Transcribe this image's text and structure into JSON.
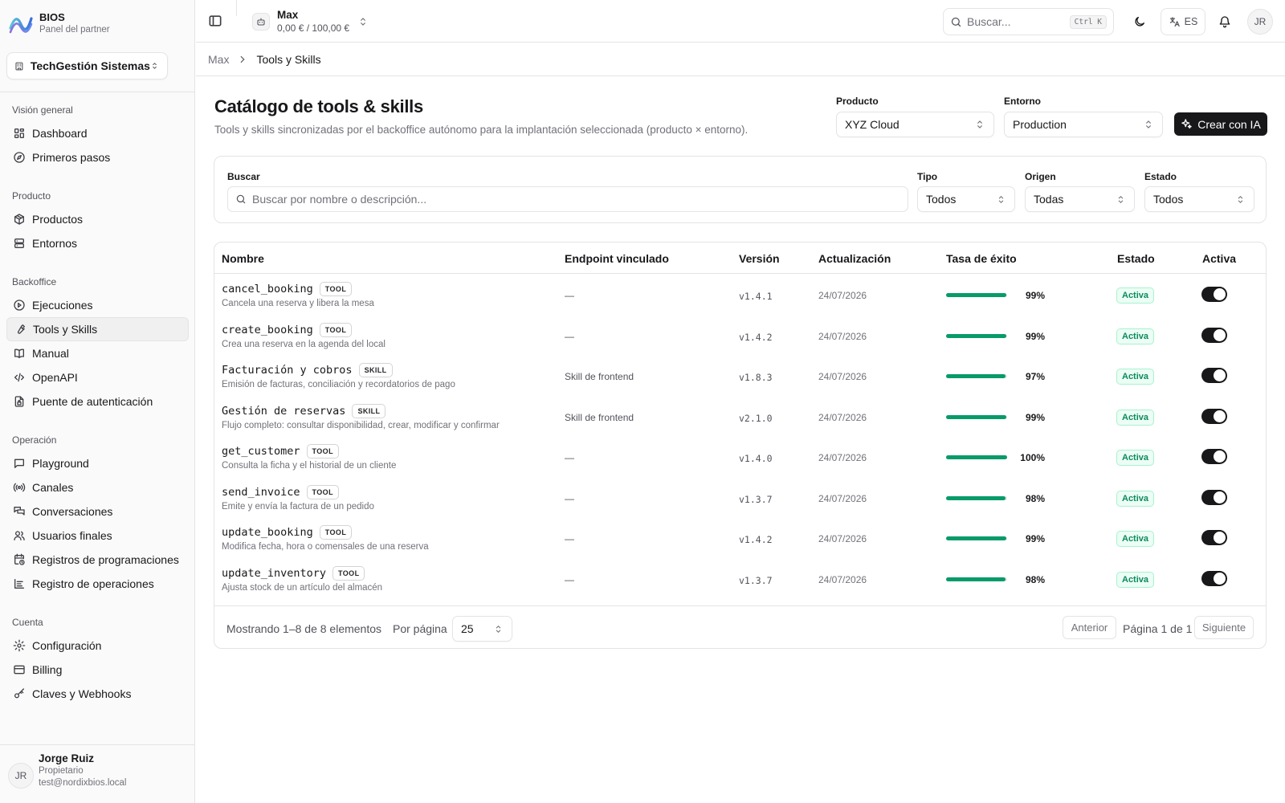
{
  "brand": {
    "title": "BIOS",
    "subtitle": "Panel del partner"
  },
  "org": {
    "name": "TechGestión Sistemas"
  },
  "sidebar": {
    "groups": [
      {
        "label": "Visión general",
        "items": [
          {
            "label": "Dashboard",
            "icon": "dashboard-icon"
          },
          {
            "label": "Primeros pasos",
            "icon": "compass-icon"
          }
        ]
      },
      {
        "label": "Producto",
        "items": [
          {
            "label": "Productos",
            "icon": "package-icon"
          },
          {
            "label": "Entornos",
            "icon": "server-icon"
          }
        ]
      },
      {
        "label": "Backoffice",
        "items": [
          {
            "label": "Ejecuciones",
            "icon": "play-circle-icon"
          },
          {
            "label": "Tools y Skills",
            "icon": "wrench-icon",
            "active": true
          },
          {
            "label": "Manual",
            "icon": "book-icon"
          },
          {
            "label": "OpenAPI",
            "icon": "code-icon"
          },
          {
            "label": "Puente de autenticación",
            "icon": "file-lock-icon"
          }
        ]
      },
      {
        "label": "Operación",
        "items": [
          {
            "label": "Playground",
            "icon": "chat-icon"
          },
          {
            "label": "Canales",
            "icon": "broadcast-icon"
          },
          {
            "label": "Conversaciones",
            "icon": "messages-icon"
          },
          {
            "label": "Usuarios finales",
            "icon": "users-icon"
          },
          {
            "label": "Registros de programaciones",
            "icon": "calendar-clock-icon"
          },
          {
            "label": "Registro de operaciones",
            "icon": "log-icon"
          }
        ]
      },
      {
        "label": "Cuenta",
        "items": [
          {
            "label": "Configuración",
            "icon": "gear-icon"
          },
          {
            "label": "Billing",
            "icon": "credit-card-icon"
          },
          {
            "label": "Claves y Webhooks",
            "icon": "key-icon"
          }
        ]
      }
    ]
  },
  "user": {
    "initials": "JR",
    "name": "Jorge Ruiz",
    "role": "Propietario",
    "email": "test@nordixbios.local"
  },
  "topbar": {
    "agent_name": "Max",
    "agent_balance": "0,00 € / 100,00 €",
    "search_placeholder": "Buscar...",
    "search_shortcut": "Ctrl K",
    "lang": "ES",
    "avatar": "JR"
  },
  "breadcrumb": {
    "parent": "Max",
    "current": "Tools y Skills"
  },
  "header": {
    "title": "Catálogo de tools & skills",
    "subtitle": "Tools y skills sincronizadas por el backoffice autónomo para la implantación seleccionada (producto × entorno).",
    "product_label": "Producto",
    "product_value": "XYZ Cloud",
    "env_label": "Entorno",
    "env_value": "Production",
    "create_label": "Crear con IA"
  },
  "filters": {
    "search_label": "Buscar",
    "search_placeholder": "Buscar por nombre o descripción...",
    "type_label": "Tipo",
    "type_value": "Todos",
    "origin_label": "Origen",
    "origin_value": "Todas",
    "status_label": "Estado",
    "status_value": "Todos"
  },
  "table": {
    "columns": [
      "Nombre",
      "Endpoint vinculado",
      "Versión",
      "Actualización",
      "Tasa de éxito",
      "Estado",
      "Activa"
    ],
    "rows": [
      {
        "name": "cancel_booking",
        "type": "TOOL",
        "desc": "Cancela una reserva y libera la mesa",
        "endpoint": "—",
        "version": "v1.4.1",
        "updated": "24/07/2026",
        "success": 99,
        "success_label": "99%",
        "status": "Activa",
        "active": true
      },
      {
        "name": "create_booking",
        "type": "TOOL",
        "desc": "Crea una reserva en la agenda del local",
        "endpoint": "—",
        "version": "v1.4.2",
        "updated": "24/07/2026",
        "success": 99,
        "success_label": "99%",
        "status": "Activa",
        "active": true
      },
      {
        "name": "Facturación y cobros",
        "type": "SKILL",
        "desc": "Emisión de facturas, conciliación y recordatorios de pago",
        "endpoint": "Skill de frontend",
        "version": "v1.8.3",
        "updated": "24/07/2026",
        "success": 97,
        "success_label": "97%",
        "status": "Activa",
        "active": true
      },
      {
        "name": "Gestión de reservas",
        "type": "SKILL",
        "desc": "Flujo completo: consultar disponibilidad, crear, modificar y confirmar",
        "endpoint": "Skill de frontend",
        "version": "v2.1.0",
        "updated": "24/07/2026",
        "success": 99,
        "success_label": "99%",
        "status": "Activa",
        "active": true
      },
      {
        "name": "get_customer",
        "type": "TOOL",
        "desc": "Consulta la ficha y el historial de un cliente",
        "endpoint": "—",
        "version": "v1.4.0",
        "updated": "24/07/2026",
        "success": 100,
        "success_label": "100%",
        "status": "Activa",
        "active": true
      },
      {
        "name": "send_invoice",
        "type": "TOOL",
        "desc": "Emite y envía la factura de un pedido",
        "endpoint": "—",
        "version": "v1.3.7",
        "updated": "24/07/2026",
        "success": 98,
        "success_label": "98%",
        "status": "Activa",
        "active": true
      },
      {
        "name": "update_booking",
        "type": "TOOL",
        "desc": "Modifica fecha, hora o comensales de una reserva",
        "endpoint": "—",
        "version": "v1.4.2",
        "updated": "24/07/2026",
        "success": 99,
        "success_label": "99%",
        "status": "Activa",
        "active": true
      },
      {
        "name": "update_inventory",
        "type": "TOOL",
        "desc": "Ajusta stock de un artículo del almacén",
        "endpoint": "—",
        "version": "v1.3.7",
        "updated": "24/07/2026",
        "success": 98,
        "success_label": "98%",
        "status": "Activa",
        "active": true
      }
    ]
  },
  "pagination": {
    "showing": "Mostrando 1–8 de 8 elementos",
    "per_page_label": "Por página",
    "per_page_value": "25",
    "prev": "Anterior",
    "info": "Página 1 de 1",
    "next": "Siguiente"
  },
  "colors": {
    "accent": "#18181b",
    "success": "#089b6a",
    "status_bg": "#ecfdf5"
  }
}
